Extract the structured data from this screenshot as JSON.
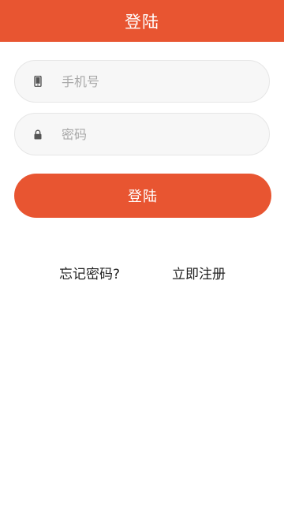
{
  "header": {
    "title": "登陆"
  },
  "form": {
    "phone": {
      "placeholder": "手机号",
      "value": "",
      "icon": "phone-icon"
    },
    "password": {
      "placeholder": "密码",
      "value": "",
      "icon": "lock-icon"
    },
    "login_label": "登陆"
  },
  "links": {
    "forgot_password": "忘记密码?",
    "register": "立即注册"
  },
  "colors": {
    "accent": "#e85531",
    "field_background": "#f7f7f7",
    "placeholder": "#a8a8a8"
  }
}
